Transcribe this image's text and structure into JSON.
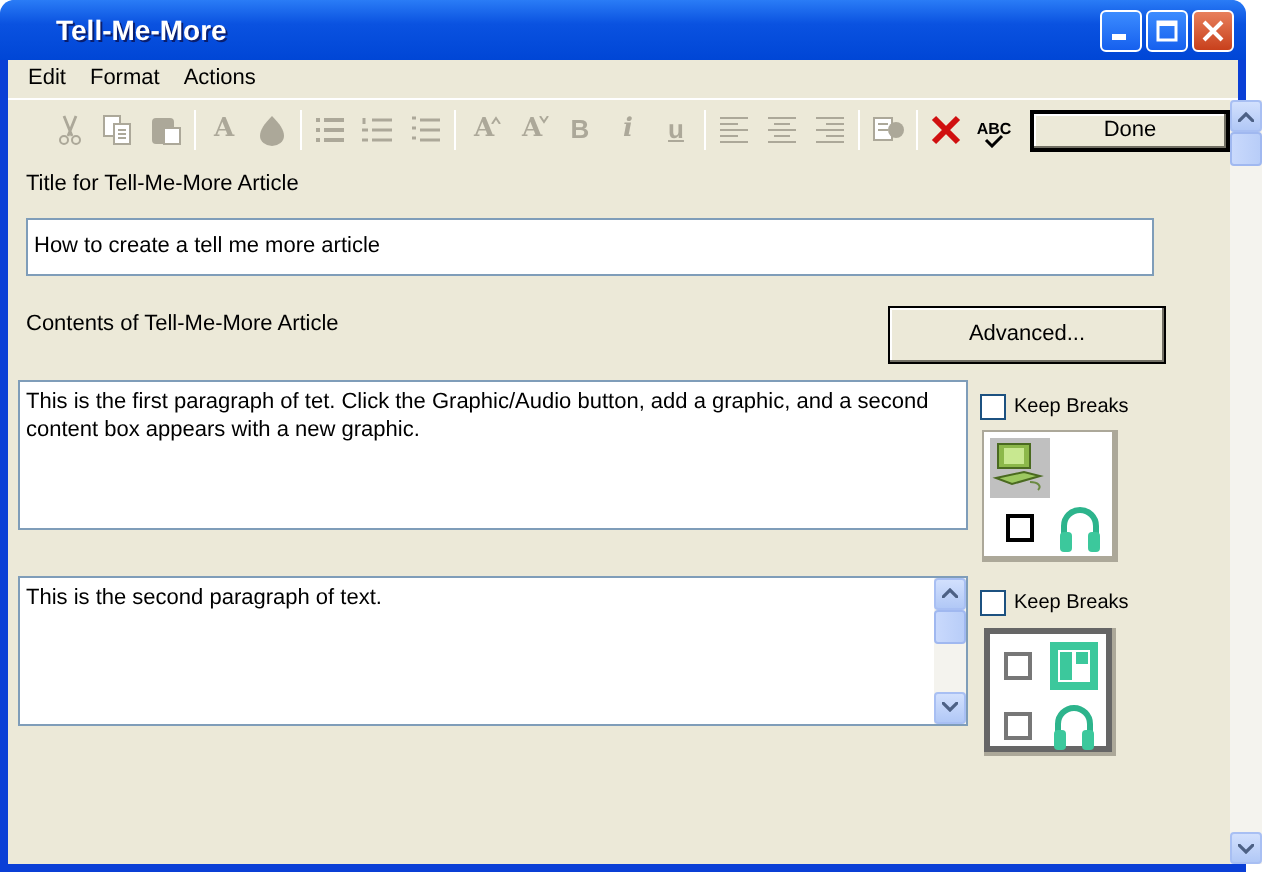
{
  "window": {
    "title": "Tell-Me-More"
  },
  "menu": [
    "Edit",
    "Format",
    "Actions"
  ],
  "toolbar": [
    {
      "kind": "button",
      "disabled": true
    },
    {
      "kind": "button",
      "disabled": true
    },
    {
      "kind": "button",
      "disabled": true
    },
    {
      "kind": "separator"
    },
    {
      "kind": "button",
      "disabled": true,
      "glyph": "A"
    },
    {
      "kind": "button",
      "disabled": true
    },
    {
      "kind": "separator"
    },
    {
      "kind": "button",
      "disabled": true
    },
    {
      "kind": "button",
      "disabled": true
    },
    {
      "kind": "button",
      "disabled": true
    },
    {
      "kind": "separator"
    },
    {
      "kind": "button",
      "disabled": true,
      "glyph": "A"
    },
    {
      "kind": "button",
      "disabled": true,
      "glyph": "A"
    },
    {
      "kind": "button",
      "disabled": true,
      "glyph": "B"
    },
    {
      "kind": "button",
      "disabled": true,
      "glyph": "i"
    },
    {
      "kind": "button",
      "disabled": true,
      "glyph": "u"
    },
    {
      "kind": "separator"
    },
    {
      "kind": "button",
      "disabled": true
    },
    {
      "kind": "button",
      "disabled": true
    },
    {
      "kind": "button",
      "disabled": true
    },
    {
      "kind": "separator"
    },
    {
      "kind": "button",
      "disabled": true
    },
    {
      "kind": "separator"
    },
    {
      "kind": "button",
      "disabled": false
    },
    {
      "kind": "button",
      "disabled": false,
      "glyph": "ABC"
    }
  ],
  "done_button": "Done",
  "title_label": "Title for Tell-Me-More Article",
  "title_value": "How to create a tell me more article",
  "contents_label": "Contents of Tell-Me-More Article",
  "advanced_button": "Advanced...",
  "paragraphs": [
    {
      "text": "This is the first paragraph of tet. Click the Graphic/Audio button, add a graphic, and a second content box appears with a new graphic.",
      "scrollbar": false,
      "keep_breaks": {
        "label": "Keep Breaks",
        "checked": false
      },
      "media": {
        "selected": false,
        "slots": [
          {
            "kind": "graphic"
          },
          {
            "kind": "empty"
          },
          {
            "kind": "checkbox",
            "disabled": false
          },
          {
            "kind": "audio"
          }
        ]
      }
    },
    {
      "text": "This is the second paragraph of text.",
      "scrollbar": true,
      "keep_breaks": {
        "label": "Keep Breaks",
        "checked": false
      },
      "media": {
        "selected": true,
        "slots": [
          {
            "kind": "checkbox",
            "disabled": true
          },
          {
            "kind": "frame"
          },
          {
            "kind": "checkbox",
            "disabled": true
          },
          {
            "kind": "audio"
          }
        ]
      }
    }
  ]
}
